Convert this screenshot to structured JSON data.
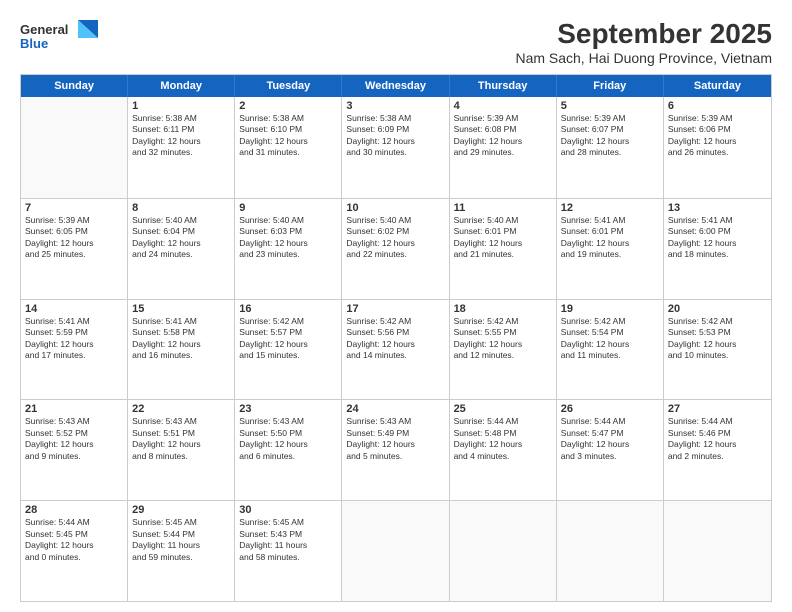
{
  "header": {
    "logo_general": "General",
    "logo_blue": "Blue",
    "title": "September 2025",
    "subtitle": "Nam Sach, Hai Duong Province, Vietnam"
  },
  "weekdays": [
    "Sunday",
    "Monday",
    "Tuesday",
    "Wednesday",
    "Thursday",
    "Friday",
    "Saturday"
  ],
  "weeks": [
    [
      {
        "day": "",
        "info": ""
      },
      {
        "day": "1",
        "info": "Sunrise: 5:38 AM\nSunset: 6:11 PM\nDaylight: 12 hours\nand 32 minutes."
      },
      {
        "day": "2",
        "info": "Sunrise: 5:38 AM\nSunset: 6:10 PM\nDaylight: 12 hours\nand 31 minutes."
      },
      {
        "day": "3",
        "info": "Sunrise: 5:38 AM\nSunset: 6:09 PM\nDaylight: 12 hours\nand 30 minutes."
      },
      {
        "day": "4",
        "info": "Sunrise: 5:39 AM\nSunset: 6:08 PM\nDaylight: 12 hours\nand 29 minutes."
      },
      {
        "day": "5",
        "info": "Sunrise: 5:39 AM\nSunset: 6:07 PM\nDaylight: 12 hours\nand 28 minutes."
      },
      {
        "day": "6",
        "info": "Sunrise: 5:39 AM\nSunset: 6:06 PM\nDaylight: 12 hours\nand 26 minutes."
      }
    ],
    [
      {
        "day": "7",
        "info": "Sunrise: 5:39 AM\nSunset: 6:05 PM\nDaylight: 12 hours\nand 25 minutes."
      },
      {
        "day": "8",
        "info": "Sunrise: 5:40 AM\nSunset: 6:04 PM\nDaylight: 12 hours\nand 24 minutes."
      },
      {
        "day": "9",
        "info": "Sunrise: 5:40 AM\nSunset: 6:03 PM\nDaylight: 12 hours\nand 23 minutes."
      },
      {
        "day": "10",
        "info": "Sunrise: 5:40 AM\nSunset: 6:02 PM\nDaylight: 12 hours\nand 22 minutes."
      },
      {
        "day": "11",
        "info": "Sunrise: 5:40 AM\nSunset: 6:01 PM\nDaylight: 12 hours\nand 21 minutes."
      },
      {
        "day": "12",
        "info": "Sunrise: 5:41 AM\nSunset: 6:01 PM\nDaylight: 12 hours\nand 19 minutes."
      },
      {
        "day": "13",
        "info": "Sunrise: 5:41 AM\nSunset: 6:00 PM\nDaylight: 12 hours\nand 18 minutes."
      }
    ],
    [
      {
        "day": "14",
        "info": "Sunrise: 5:41 AM\nSunset: 5:59 PM\nDaylight: 12 hours\nand 17 minutes."
      },
      {
        "day": "15",
        "info": "Sunrise: 5:41 AM\nSunset: 5:58 PM\nDaylight: 12 hours\nand 16 minutes."
      },
      {
        "day": "16",
        "info": "Sunrise: 5:42 AM\nSunset: 5:57 PM\nDaylight: 12 hours\nand 15 minutes."
      },
      {
        "day": "17",
        "info": "Sunrise: 5:42 AM\nSunset: 5:56 PM\nDaylight: 12 hours\nand 14 minutes."
      },
      {
        "day": "18",
        "info": "Sunrise: 5:42 AM\nSunset: 5:55 PM\nDaylight: 12 hours\nand 12 minutes."
      },
      {
        "day": "19",
        "info": "Sunrise: 5:42 AM\nSunset: 5:54 PM\nDaylight: 12 hours\nand 11 minutes."
      },
      {
        "day": "20",
        "info": "Sunrise: 5:42 AM\nSunset: 5:53 PM\nDaylight: 12 hours\nand 10 minutes."
      }
    ],
    [
      {
        "day": "21",
        "info": "Sunrise: 5:43 AM\nSunset: 5:52 PM\nDaylight: 12 hours\nand 9 minutes."
      },
      {
        "day": "22",
        "info": "Sunrise: 5:43 AM\nSunset: 5:51 PM\nDaylight: 12 hours\nand 8 minutes."
      },
      {
        "day": "23",
        "info": "Sunrise: 5:43 AM\nSunset: 5:50 PM\nDaylight: 12 hours\nand 6 minutes."
      },
      {
        "day": "24",
        "info": "Sunrise: 5:43 AM\nSunset: 5:49 PM\nDaylight: 12 hours\nand 5 minutes."
      },
      {
        "day": "25",
        "info": "Sunrise: 5:44 AM\nSunset: 5:48 PM\nDaylight: 12 hours\nand 4 minutes."
      },
      {
        "day": "26",
        "info": "Sunrise: 5:44 AM\nSunset: 5:47 PM\nDaylight: 12 hours\nand 3 minutes."
      },
      {
        "day": "27",
        "info": "Sunrise: 5:44 AM\nSunset: 5:46 PM\nDaylight: 12 hours\nand 2 minutes."
      }
    ],
    [
      {
        "day": "28",
        "info": "Sunrise: 5:44 AM\nSunset: 5:45 PM\nDaylight: 12 hours\nand 0 minutes."
      },
      {
        "day": "29",
        "info": "Sunrise: 5:45 AM\nSunset: 5:44 PM\nDaylight: 11 hours\nand 59 minutes."
      },
      {
        "day": "30",
        "info": "Sunrise: 5:45 AM\nSunset: 5:43 PM\nDaylight: 11 hours\nand 58 minutes."
      },
      {
        "day": "",
        "info": ""
      },
      {
        "day": "",
        "info": ""
      },
      {
        "day": "",
        "info": ""
      },
      {
        "day": "",
        "info": ""
      }
    ]
  ]
}
